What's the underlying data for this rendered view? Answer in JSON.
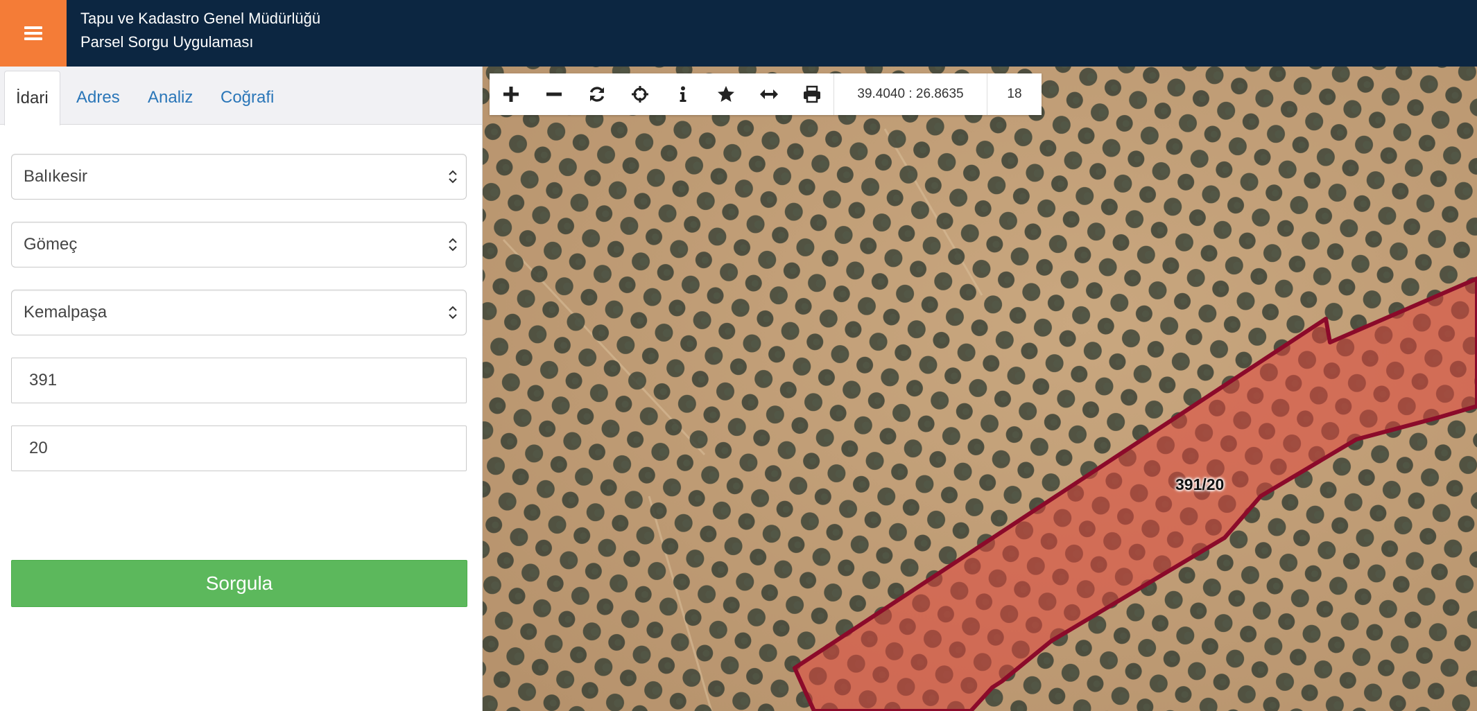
{
  "header": {
    "title_line1": "Tapu ve Kadastro Genel Müdürlüğü",
    "title_line2": "Parsel Sorgu Uygulaması",
    "menu_icon": "hamburger-icon"
  },
  "tabs": [
    {
      "label": "İdari",
      "active": true
    },
    {
      "label": "Adres",
      "active": false
    },
    {
      "label": "Analiz",
      "active": false
    },
    {
      "label": "Coğrafi",
      "active": false
    }
  ],
  "form": {
    "province": "Balıkesir",
    "district": "Gömeç",
    "neighborhood": "Kemalpaşa",
    "block": "391",
    "parcel": "20",
    "submit_label": "Sorgula"
  },
  "toolbar": {
    "tools": [
      "zoom-in-icon",
      "zoom-out-icon",
      "refresh-icon",
      "locate-icon",
      "info-icon",
      "star-icon",
      "measure-icon",
      "print-icon"
    ],
    "coordinates": "39.4040 : 26.8635",
    "zoom_level": "18"
  },
  "map": {
    "parcel_label": "391/20",
    "parcel_outline_color": "#8b0a2a",
    "parcel_fill_color": "#d9453a"
  },
  "colors": {
    "header_bg": "#0c2641",
    "menu_bg": "#f47c37",
    "accent_link": "#2a76b8",
    "submit_bg": "#5cb85c"
  }
}
